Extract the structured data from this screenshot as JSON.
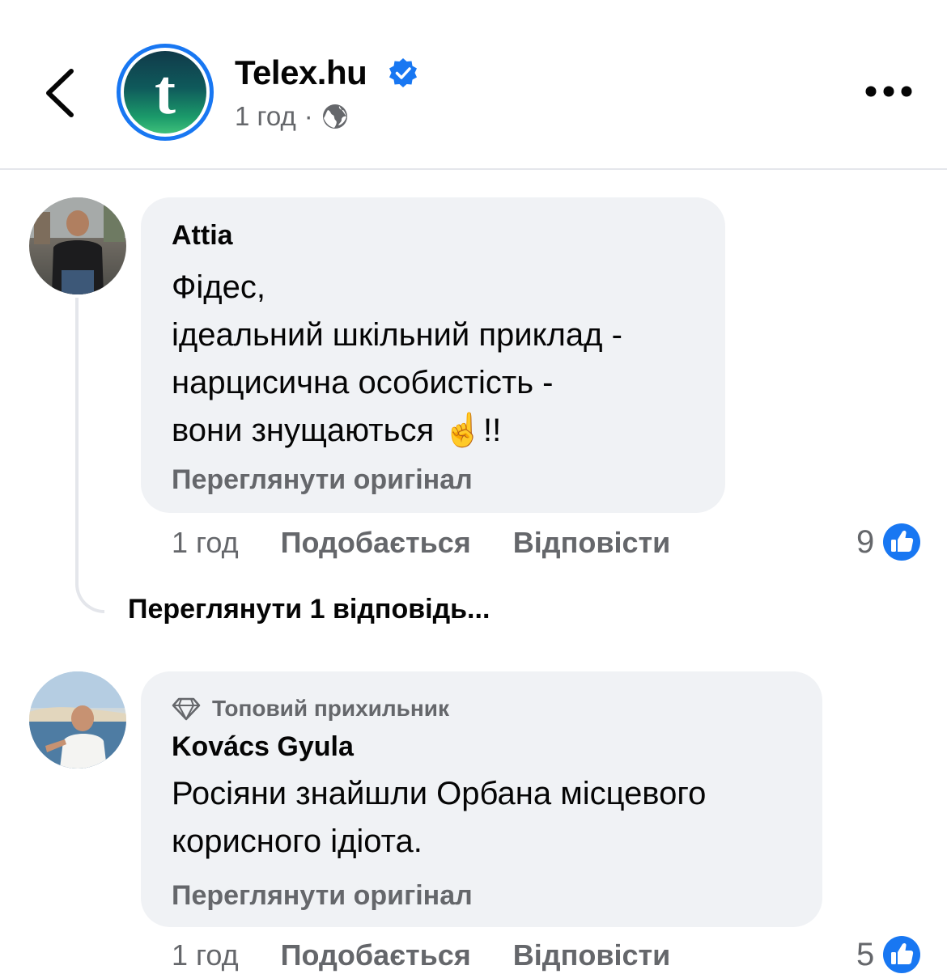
{
  "header": {
    "page_name": "Telex.hu",
    "avatar_letter": "t",
    "time": "1 год",
    "separator": "·"
  },
  "comments": [
    {
      "author": "Attia",
      "text": "Фідес,\nідеальний шкільний приклад -\nнарцисична особистість -\nвони знущаються ☝️!!",
      "see_original": "Переглянути оригінал",
      "time": "1 год",
      "like_label": "Подобається",
      "reply_label": "Відповісти",
      "reactions": "9",
      "view_replies": "Переглянути 1 відповідь..."
    },
    {
      "badge": "Топовий прихильник",
      "author": "Kovács Gyula",
      "text": "Росіяни знайшли Орбана місцевого\nкорисного ідіота.",
      "see_original": "Переглянути оригінал",
      "time": "1 год",
      "like_label": "Подобається",
      "reply_label": "Відповісти",
      "reactions": "5"
    }
  ],
  "colors": {
    "accent": "#1877f2",
    "bubble": "#f0f2f5",
    "secondary_text": "#65676b"
  }
}
